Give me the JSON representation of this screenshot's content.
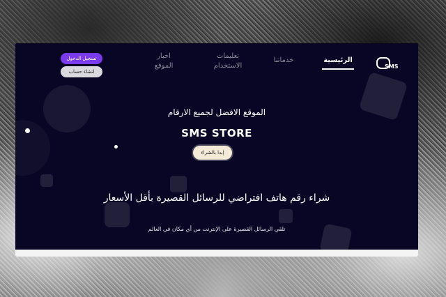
{
  "nav": {
    "logo_text": "SMS",
    "items": [
      {
        "label": "الرئيسية",
        "active": true
      },
      {
        "label": "خدماتنا",
        "active": false
      },
      {
        "label": "تعليمات\nالاستخدام",
        "active": false
      },
      {
        "label": "اخبار\nالموقع",
        "active": false
      }
    ],
    "login_label": "تسجيل الدخول",
    "signup_label": "انشاء حساب"
  },
  "hero": {
    "tagline": "الموقع الافضل لجميع الارقام",
    "brand": "SMS STORE",
    "start_button": "إبدا بالشراء",
    "headline": "شراء رقم هاتف افتراضي للرسائل القصيرة بأقل الأسعار",
    "subheadline": "تلقي الرسائل القصيرة على الإنترنت من أي مكان في العالم"
  },
  "colors": {
    "background": "#090625",
    "accent": "#7c3aed"
  },
  "icons": {
    "logo": "chat-bubble-icon"
  }
}
